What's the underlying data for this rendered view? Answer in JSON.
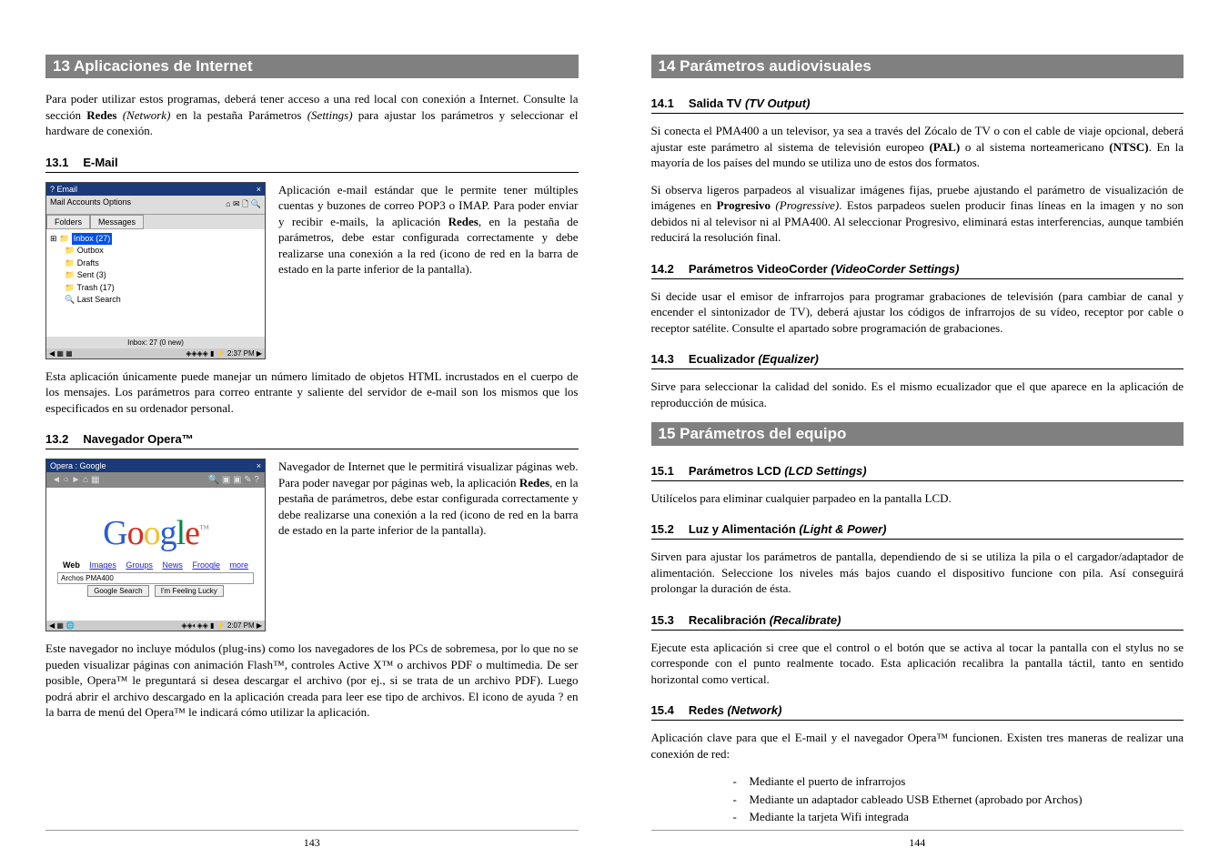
{
  "left": {
    "sec13_header": "13   Aplicaciones de Internet",
    "sec13_intro": "Para poder utilizar estos programas, deberá tener acceso a una red local con conexión a Internet. Consulte la sección Redes (Network) en la pestaña Parámetros (Settings) para ajustar los parámetros y seleccionar el hardware de conexión.",
    "sub131_num": "13.1",
    "sub131_title": "E-Mail",
    "email": {
      "title": "Email",
      "menu_left": "Mail   Accounts   Options",
      "tab1": "Folders",
      "tab2": "Messages",
      "inbox": "Inbox (27)",
      "outbox": "Outbox",
      "drafts": "Drafts",
      "sent": "Sent (3)",
      "trash": "Trash (17)",
      "last": "Last Search",
      "status": "Inbox: 27 (0 new)",
      "time": "2:37 PM"
    },
    "email_side": "Aplicación e-mail estándar que le permite tener múltiples cuentas y buzones de correo POP3 o IMAP. Para poder enviar y recibir e-mails, la aplicación Redes, en la pestaña de parámetros, debe estar configurada correctamente y debe realizarse una conexión a la red (icono de red en la barra de estado en la parte inferior de la pantalla).",
    "email_after": "Esta aplicación únicamente puede manejar un número limitado de objetos HTML incrustados en el cuerpo de los mensajes. Los parámetros para correo entrante y saliente del servidor de e-mail son los mismos que los especificados en su ordenador personal.",
    "sub132_num": "13.2",
    "sub132_title": "Navegador Opera™",
    "opera": {
      "title": "Opera : Google",
      "toolbar_left": "◄ ○ ► ⌂ ▦",
      "toolbar_right": "🔍 ▣ ▣ ✎ ?",
      "search_val": "Archos PMA400",
      "btn1": "Google Search",
      "btn2": "I'm Feeling Lucky",
      "tab_web": "Web",
      "tab_images": "Images",
      "tab_groups": "Groups",
      "tab_news": "News",
      "tab_froogle": "Froogle",
      "tab_more": "more",
      "time": "2:07 PM"
    },
    "opera_side": "Navegador de Internet que le permitirá visualizar páginas web. Para poder navegar por páginas web, la aplicación Redes, en la pestaña de parámetros, debe estar configurada correctamente y debe realizarse una conexión a la red (icono de red en la barra de estado en la parte inferior de la pantalla).",
    "opera_after": "Este navegador no incluye módulos (plug-ins) como los navegadores de los PCs de sobremesa, por lo que no se pueden visualizar páginas con animación Flash™, controles Active X™ o archivos PDF o multimedia. De ser posible, Opera™ le preguntará si desea descargar el archivo (por ej., si se trata de un archivo PDF). Luego podrá abrir el archivo descargado en la aplicación creada para leer ese tipo de archivos. El icono de ayuda ? en la barra de menú del Opera™ le indicará cómo utilizar la aplicación.",
    "page_num": "143"
  },
  "right": {
    "sec14_header": "14   Parámetros audiovisuales",
    "sub141_num": "14.1",
    "sub141_title_a": "Salida TV ",
    "sub141_title_b": "(TV Output)",
    "p141a": "Si conecta el PMA400 a un televisor, ya sea a través del Zócalo de TV o con el cable de viaje opcional, deberá ajustar este parámetro al sistema de televisión europeo (PAL) o al sistema norteamericano (NTSC). En la mayoría de los países del mundo se utiliza uno de estos dos formatos.",
    "p141b": "Si observa ligeros parpadeos al visualizar imágenes fijas, pruebe ajustando el parámetro de visualización de imágenes en Progresivo (Progressive). Estos parpadeos suelen producir finas líneas en la imagen y no son debidos ni al televisor ni al PMA400. Al seleccionar Progresivo, eliminará estas interferencias, aunque también reducirá la resolución final.",
    "sub142_num": "14.2",
    "sub142_title_a": "Parámetros VideoCorder ",
    "sub142_title_b": "(VideoCorder Settings)",
    "p142": "Si decide usar el emisor de infrarrojos para programar grabaciones de televisión (para cambiar de canal y encender el sintonizador de TV), deberá ajustar los códigos de infrarrojos de su vídeo, receptor por cable o receptor satélite. Consulte el apartado sobre programación de grabaciones.",
    "sub143_num": "14.3",
    "sub143_title_a": "Ecualizador ",
    "sub143_title_b": "(Equalizer)",
    "p143": "Sirve para seleccionar la calidad del sonido. Es el mismo ecualizador que el que aparece en la aplicación de reproducción de música.",
    "sec15_header": "15   Parámetros del equipo",
    "sub151_num": "15.1",
    "sub151_title_a": "Parámetros LCD ",
    "sub151_title_b": "(LCD Settings)",
    "p151": "Utilícelos para eliminar cualquier parpadeo en la pantalla LCD.",
    "sub152_num": "15.2",
    "sub152_title_a": "Luz y Alimentación ",
    "sub152_title_b": "(Light & Power)",
    "p152": "Sirven para ajustar los parámetros de pantalla, dependiendo de si se utiliza la pila o el cargador/adaptador de alimentación. Seleccione los niveles más bajos cuando el dispositivo funcione con pila. Así conseguirá prolongar la duración de ésta.",
    "sub153_num": "15.3",
    "sub153_title_a": "Recalibración ",
    "sub153_title_b": "(Recalibrate)",
    "p153": "Ejecute esta aplicación si cree que el control o el botón que se activa al tocar la pantalla con el stylus no se corresponde con el punto realmente tocado. Esta aplicación recalibra la pantalla táctil, tanto en sentido horizontal como vertical.",
    "sub154_num": "15.4",
    "sub154_title_a": "Redes ",
    "sub154_title_b": "(Network)",
    "p154": "Aplicación clave para que el E-mail y el navegador Opera™ funcionen. Existen tres maneras de realizar una conexión de red:",
    "list1": "Mediante el puerto de infrarrojos",
    "list2": "Mediante un adaptador cableado USB Ethernet (aprobado por Archos)",
    "list3": "Mediante la tarjeta Wifi integrada",
    "page_num": "144"
  }
}
